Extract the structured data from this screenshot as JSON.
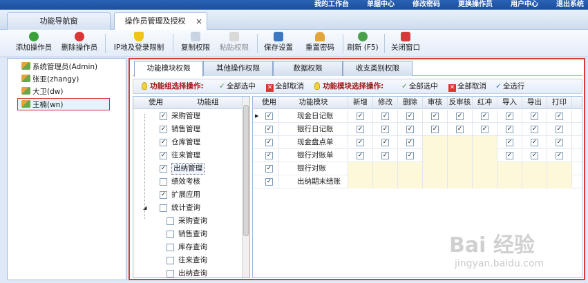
{
  "top_nav": [
    "我的工作台",
    "单据中心",
    "修改密码",
    "更换操作员",
    "用户中心",
    "退出系统"
  ],
  "tabs": [
    {
      "label": "功能导航窗"
    },
    {
      "label": "操作员管理及授权",
      "close": "×"
    }
  ],
  "toolbar": {
    "add": "添加操作员",
    "delete": "删除操作员",
    "ip_limit": "IP地及登录限制",
    "copy": "复制权限",
    "paste": "粘贴权限",
    "save": "保存设置",
    "reset_pwd": "重置密码",
    "refresh": "刷新 (F5)",
    "close": "关闭窗口"
  },
  "users": [
    "系统管理员(Admin)",
    "张亚(zhangy)",
    "大卫(dw)",
    "王楠(wn)"
  ],
  "subtabs": [
    "功能模块权限",
    "其他操作权限",
    "数据权限",
    "收支类别权限"
  ],
  "opbar": {
    "group_label": "功能组选择操作:",
    "select_all": "全部选中",
    "deselect_all": "全部取消",
    "module_label": "功能模块选择操作:",
    "select_all2": "全部选中",
    "deselect_all2": "全部取消",
    "select_row": "全选行"
  },
  "group_grid": {
    "col_use": "使用",
    "col_group": "功能组",
    "rows": [
      {
        "label": "采购管理",
        "checked": true
      },
      {
        "label": "销售管理",
        "checked": true
      },
      {
        "label": "仓库管理",
        "checked": true
      },
      {
        "label": "往来管理",
        "checked": true
      },
      {
        "label": "出纳管理",
        "checked": true,
        "highlight": true
      },
      {
        "label": "绩效考核",
        "checked": false
      },
      {
        "label": "扩展应用",
        "checked": true
      },
      {
        "label": "统计查询",
        "checked": false,
        "expander": "◢"
      },
      {
        "label": "采购查询",
        "checked": false,
        "child": true
      },
      {
        "label": "销售查询",
        "checked": false,
        "child": true
      },
      {
        "label": "库存查询",
        "checked": false,
        "child": true
      },
      {
        "label": "往来查询",
        "checked": false,
        "child": true
      },
      {
        "label": "出纳查询",
        "checked": false,
        "child": true
      }
    ]
  },
  "module_grid": {
    "headers": [
      "使用",
      "功能模块",
      "新增",
      "修改",
      "删除",
      "审核",
      "反审核",
      "红冲",
      "导入",
      "导出",
      "打印"
    ],
    "rows": [
      {
        "name": "现金日记账",
        "use": true,
        "perms": [
          true,
          true,
          true,
          true,
          true,
          true,
          true,
          true,
          true
        ],
        "current": "▶"
      },
      {
        "name": "银行日记账",
        "use": true,
        "perms": [
          true,
          true,
          true,
          true,
          true,
          true,
          true,
          true,
          true
        ]
      },
      {
        "name": "现金盘点单",
        "use": true,
        "perms": [
          true,
          true,
          true,
          false,
          false,
          false,
          true,
          true,
          true
        ]
      },
      {
        "name": "银行对账单",
        "use": true,
        "perms": [
          true,
          true,
          true,
          false,
          false,
          false,
          true,
          true,
          true
        ]
      },
      {
        "name": "银行对账",
        "use": true,
        "perms": [
          false,
          false,
          false,
          false,
          false,
          false,
          false,
          false,
          false
        ]
      },
      {
        "name": "出纳期末结账",
        "use": true,
        "perms": [
          false,
          false,
          false,
          false,
          false,
          false,
          false,
          false,
          false
        ]
      }
    ]
  },
  "watermark": {
    "line1": "Bai 经验",
    "line2": "jingyan.baidu.com"
  },
  "check_glyph": "✓",
  "colors": {
    "accent": "#1d4f9c",
    "highlight_border": "#d93a3a",
    "empty_cell": "#fdf8d9"
  }
}
